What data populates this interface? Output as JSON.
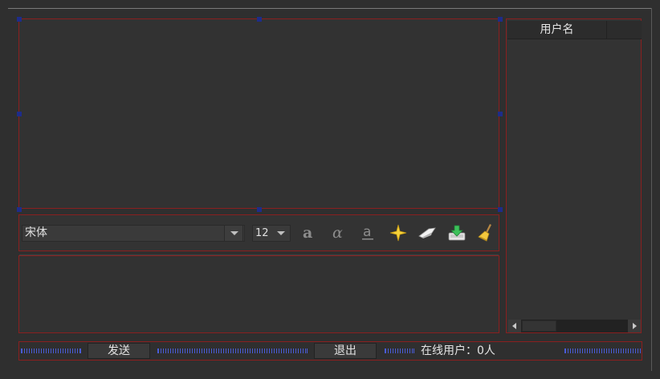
{
  "toolbar": {
    "font_family_value": "宋体",
    "font_size_value": "12"
  },
  "user_list": {
    "column_header": "用户名"
  },
  "bottom": {
    "send_label": "发送",
    "exit_label": "退出",
    "online_label": "在线用户：",
    "online_count": "0人"
  },
  "icons": {
    "bold": "bold-a-icon",
    "italic": "italic-a-icon",
    "underline": "underline-a-icon",
    "color": "star-color-icon",
    "clear": "eraser-icon",
    "save": "save-download-icon",
    "clean": "broom-icon"
  },
  "colors": {
    "panel_border": "#8a1f1f",
    "spacer": "#4a5cd8",
    "background": "#2f2f2f"
  }
}
